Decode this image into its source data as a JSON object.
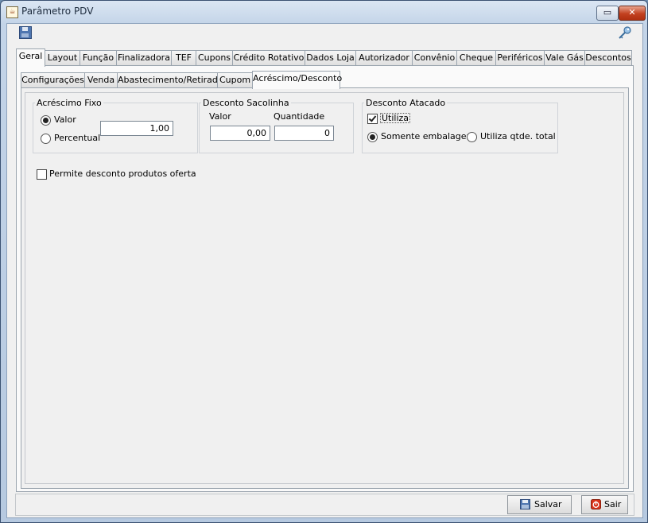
{
  "window": {
    "title": "Parâmetro PDV",
    "restore_glyph": "▭",
    "close_glyph": "✕"
  },
  "icons": {
    "app": "java-cup-icon",
    "toolbar_save": "floppy-disk-icon",
    "toolbar_key": "key-icon",
    "save_button": "floppy-disk-icon",
    "exit_button": "power-icon"
  },
  "main_tabs": [
    "Geral",
    "Layout",
    "Função",
    "Finalizadora",
    "TEF",
    "Cupons",
    "Crédito Rotativo",
    "Dados Loja",
    "Autorizador",
    "Convênio",
    "Cheque",
    "Periféricos",
    "Vale Gás",
    "Descontos"
  ],
  "main_tab_active": "Geral",
  "sub_tabs": [
    "Configurações",
    "Venda",
    "Abastecimento/Retirada",
    "Cupom",
    "Acréscimo/Desconto"
  ],
  "sub_tab_active": "Acréscimo/Desconto",
  "acrescimo_fixo": {
    "legend": "Acréscimo Fixo",
    "option_valor": "Valor",
    "option_percentual": "Percentual",
    "selected": "Valor",
    "value": "1,00"
  },
  "desconto_sacolinha": {
    "legend": "Desconto Sacolinha",
    "valor_label": "Valor",
    "quantidade_label": "Quantidade",
    "valor": "0,00",
    "quantidade": "0"
  },
  "desconto_atacado": {
    "legend": "Desconto Atacado",
    "utiliza_label": "Utiliza",
    "utiliza_checked": true,
    "option_somente": "Somente embalagem",
    "option_total": "Utiliza qtde. total",
    "selected": "Somente embalagem"
  },
  "permite_oferta": {
    "label": "Permite desconto produtos oferta",
    "checked": false
  },
  "buttons": {
    "save": "Salvar",
    "exit": "Sair"
  },
  "colors": {
    "close_button": "#c2401f",
    "exit_icon": "#d9341c",
    "save_icon": "#4f76b0"
  }
}
